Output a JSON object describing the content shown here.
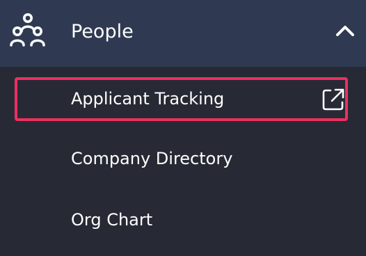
{
  "header": {
    "label": "People",
    "icon": "people-icon",
    "toggle_icon": "chevron-up-icon"
  },
  "items": [
    {
      "label": "Applicant Tracking",
      "icon": "external-link-icon",
      "highlighted": true
    },
    {
      "label": "Company Directory"
    },
    {
      "label": "Org Chart"
    }
  ],
  "colors": {
    "header_background": "#2f3a52",
    "menu_background": "#272a35",
    "text": "#ffffff",
    "highlight_border": "#ef2f5f"
  }
}
